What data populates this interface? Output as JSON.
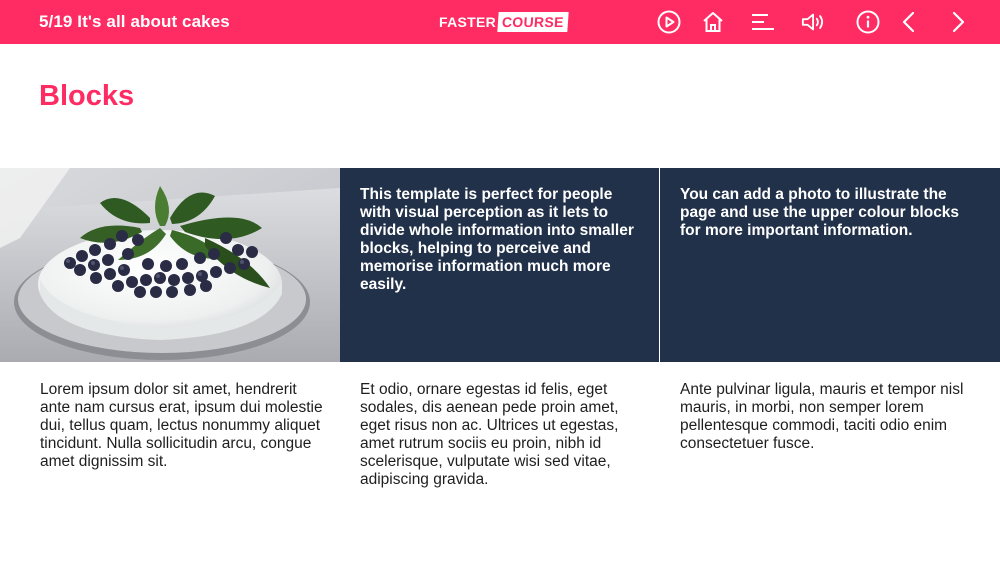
{
  "header": {
    "breadcrumb": "5/19 It's all about cakes",
    "logo_part1": "FASTER",
    "logo_part2": "COURSE",
    "nav_icons": [
      "play-icon",
      "home-icon",
      "menu-icon",
      "volume-icon",
      "info-icon",
      "chevron-left-icon",
      "chevron-right-icon"
    ]
  },
  "page": {
    "title": "Blocks"
  },
  "blocks": {
    "panel_1": "This template is perfect for people with visual perception as it lets to divide whole information into smaller blocks, helping to perceive and memorise information much more easily.",
    "panel_2": "You can add a photo to illustrate the page and use the upper colour blocks for more important information.",
    "text_1": "Lorem ipsum dolor sit amet, hendrerit ante nam cursus erat, ipsum dui molestie dui, tellus quam, lectus nonummy aliquet tincidunt. Nulla sollicitudin arcu, congue amet dignissim sit.",
    "text_2": "Et odio, ornare egestas id felis, eget sodales, dis aenean pede proin amet, eget risus non ac. Ultrices ut egestas, amet rutrum sociis eu proin, nibh id scelerisque, vulputate wisi sed vitae, adipiscing gravida.",
    "text_3": "Ante pulvinar ligula, mauris et tempor nisl mauris, in morbi, non semper lorem pellentesque commodi, taciti odio enim consectetuer fusce."
  },
  "colors": {
    "accent": "#ff2b63",
    "panel": "#22314a",
    "text": "#1e1e1e"
  }
}
